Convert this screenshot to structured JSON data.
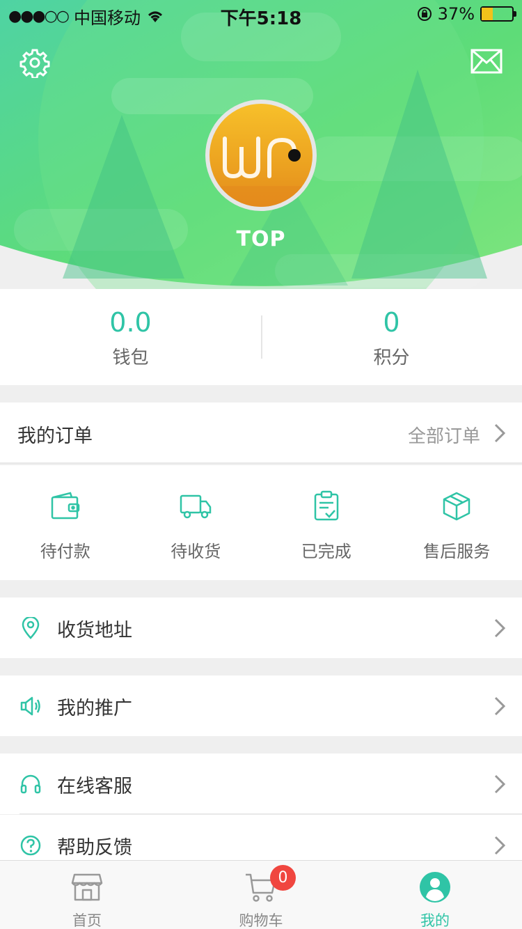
{
  "status_bar": {
    "signal": "●●●○○",
    "carrier": "中国移动",
    "time": "下午5:18",
    "battery_pct_text": "37%",
    "battery_level": 0.37
  },
  "profile": {
    "username": "TOP"
  },
  "stats": [
    {
      "value": "0.0",
      "label": "钱包"
    },
    {
      "value": "0",
      "label": "积分"
    }
  ],
  "orders": {
    "title": "我的订单",
    "all_label": "全部订单",
    "items": [
      {
        "label": "待付款",
        "icon": "wallet-icon"
      },
      {
        "label": "待收货",
        "icon": "truck-icon"
      },
      {
        "label": "已完成",
        "icon": "clipboard-check-icon"
      },
      {
        "label": "售后服务",
        "icon": "box-icon"
      }
    ]
  },
  "menu": [
    {
      "label": "收货地址",
      "icon": "location-pin-icon"
    },
    {
      "label": "我的推广",
      "icon": "speaker-icon"
    },
    {
      "label": "在线客服",
      "icon": "headset-icon"
    },
    {
      "label": "帮助反馈",
      "icon": "help-circle-icon"
    }
  ],
  "tabbar": {
    "items": [
      {
        "label": "首页",
        "icon": "store-icon"
      },
      {
        "label": "购物车",
        "icon": "cart-icon",
        "badge": "0"
      },
      {
        "label": "我的",
        "icon": "user-icon",
        "active": true
      }
    ]
  },
  "colors": {
    "accent": "#2fc4a6",
    "header_green": "#5ed670",
    "badge_red": "#f0463f",
    "avatar_yellow": "#f0a822"
  }
}
